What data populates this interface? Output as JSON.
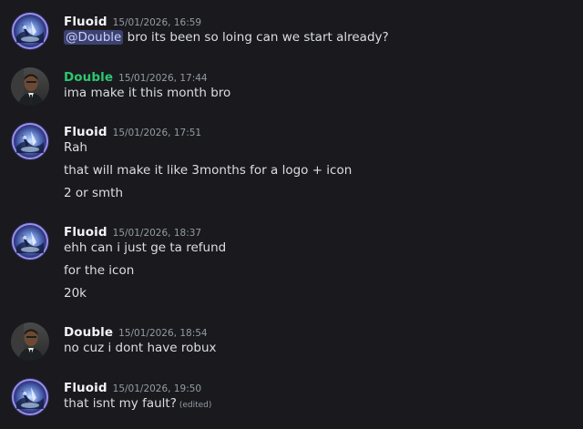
{
  "messages": [
    {
      "author": "Fluoid",
      "timestamp": "15/01/2026, 16:59",
      "mention": "@Double",
      "lines": [
        "bro its been so loing can we start already?"
      ]
    },
    {
      "author": "Double",
      "timestamp": "15/01/2026, 17:44",
      "lines": [
        "ima make it this month bro"
      ]
    },
    {
      "author": "Fluoid",
      "timestamp": "15/01/2026, 17:51",
      "lines": [
        "Rah",
        "that will make it like 3months for a logo + icon",
        "2 or smth"
      ]
    },
    {
      "author": "Fluoid",
      "timestamp": "15/01/2026, 18:37",
      "lines": [
        "ehh can i just ge ta refund",
        "for the icon",
        "20k"
      ]
    },
    {
      "author": "Double",
      "timestamp": "15/01/2026, 18:54",
      "lines": [
        "no cuz i dont have robux"
      ]
    },
    {
      "author": "Fluoid",
      "timestamp": "15/01/2026, 19:50",
      "lines": [
        "that isnt my fault?"
      ],
      "edited": "(edited)"
    }
  ],
  "colors": {
    "background": "#1a1a1e",
    "text": "#dbdee1",
    "timestamp": "#949ba4",
    "double_green": "#2dc770",
    "mention_bg": "#3c4270"
  }
}
